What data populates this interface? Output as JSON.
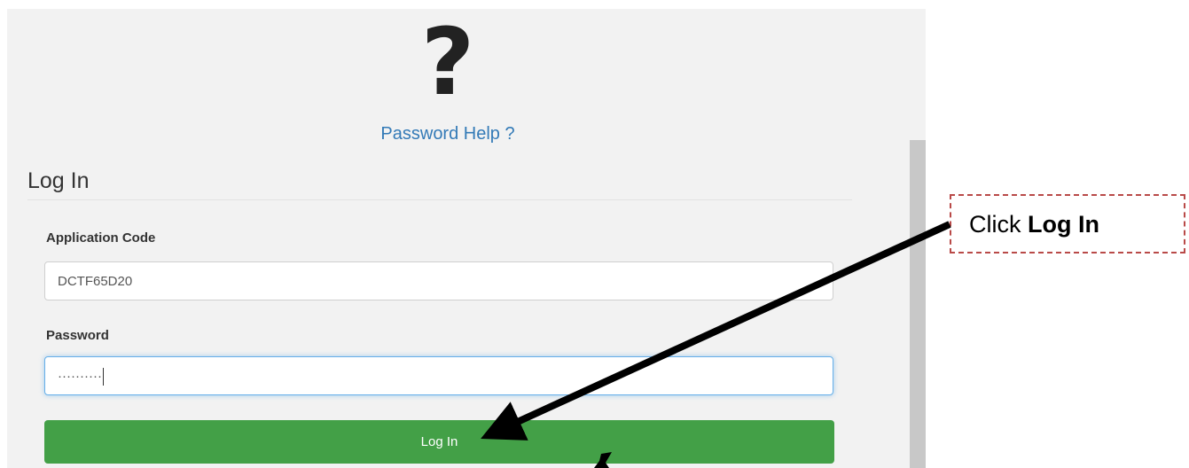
{
  "help": {
    "icon": "question-mark-icon",
    "icon_glyph": "?",
    "link_text": "Password Help ?"
  },
  "form": {
    "title": "Log In",
    "application_code": {
      "label": "Application Code",
      "value": "DCTF65D20"
    },
    "password": {
      "label": "Password",
      "masked_value": "··········"
    },
    "submit_label": "Log In"
  },
  "annotation": {
    "callout_prefix": "Click ",
    "callout_bold": "Log In"
  },
  "colors": {
    "panel_bg": "#f2f2f2",
    "link": "#337ab7",
    "button_green": "#43a047",
    "focus_border": "#66afe9",
    "callout_border": "#b94a48"
  }
}
